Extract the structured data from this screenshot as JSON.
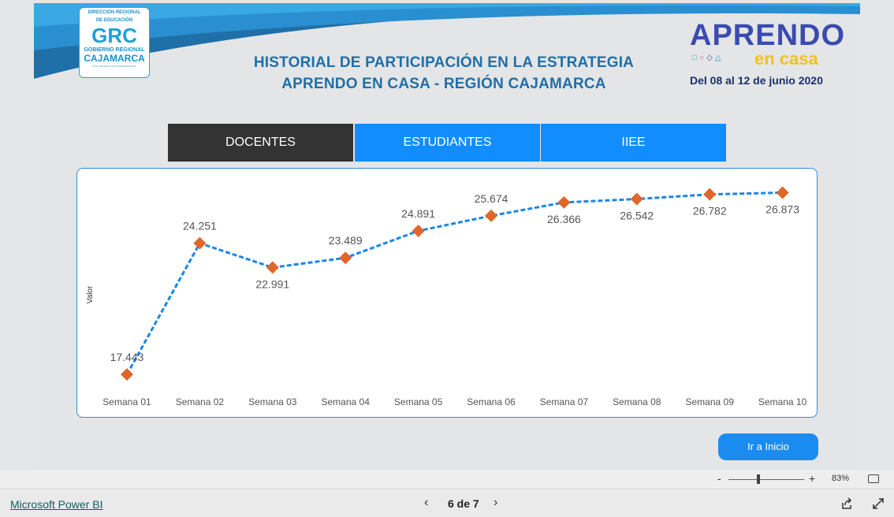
{
  "header": {
    "logo_grc": {
      "line1": "DIRECCIÓN REGIONAL",
      "line2": "DE EDUCACIÓN",
      "mark": "GRC",
      "line3": "GOBIERNO REGIONAL",
      "line4": "CAJAMARCA",
      "tagline": "A tu servicio con transparencia"
    },
    "title_line1": "HISTORIAL DE PARTICIPACIÓN EN LA ESTRATEGIA",
    "title_line2": "APRENDO EN CASA - REGIÓN CAJAMARCA",
    "aprendo_logo": {
      "word": "APRENDO",
      "sub": "en casa"
    },
    "dates": "Del 08 al 12 de junio 2020"
  },
  "tabs": [
    {
      "label": "DOCENTES",
      "active": true,
      "color": "#333333"
    },
    {
      "label": "ESTUDIANTES",
      "active": false,
      "color": "#118dff"
    },
    {
      "label": "IIEE",
      "active": false,
      "color": "#118dff"
    }
  ],
  "chart_data": {
    "type": "line",
    "title": "",
    "xlabel": "",
    "ylabel": "Valor",
    "categories": [
      "Semana 01",
      "Semana 02",
      "Semana 03",
      "Semana 04",
      "Semana 05",
      "Semana 06",
      "Semana 07",
      "Semana 08",
      "Semana 09",
      "Semana 10"
    ],
    "values": [
      17443,
      24251,
      22991,
      23489,
      24891,
      25674,
      26366,
      26542,
      26782,
      26873
    ],
    "data_labels": [
      "17.443",
      "24.251",
      "22.991",
      "23.489",
      "24.891",
      "25.674",
      "26.366",
      "26.542",
      "26.782",
      "26.873"
    ],
    "line_color": "#1a86e6",
    "marker_color": "#e0662a",
    "line_style": "dashed",
    "marker": "diamond",
    "grid": false,
    "ylim": [
      17000,
      27300
    ]
  },
  "buttons": {
    "home": "Ir a Inicio"
  },
  "zoom": {
    "minus": "-",
    "plus": "+",
    "value": "83%",
    "level_fraction": 0.4
  },
  "footer": {
    "pbi_link": "Microsoft Power BI",
    "page_indicator": "6 de 7",
    "prev": "‹",
    "next": "›"
  },
  "icons": [
    "share-icon",
    "expand-icon",
    "fit-to-page-icon",
    "chevron-left-icon",
    "chevron-right-icon"
  ]
}
